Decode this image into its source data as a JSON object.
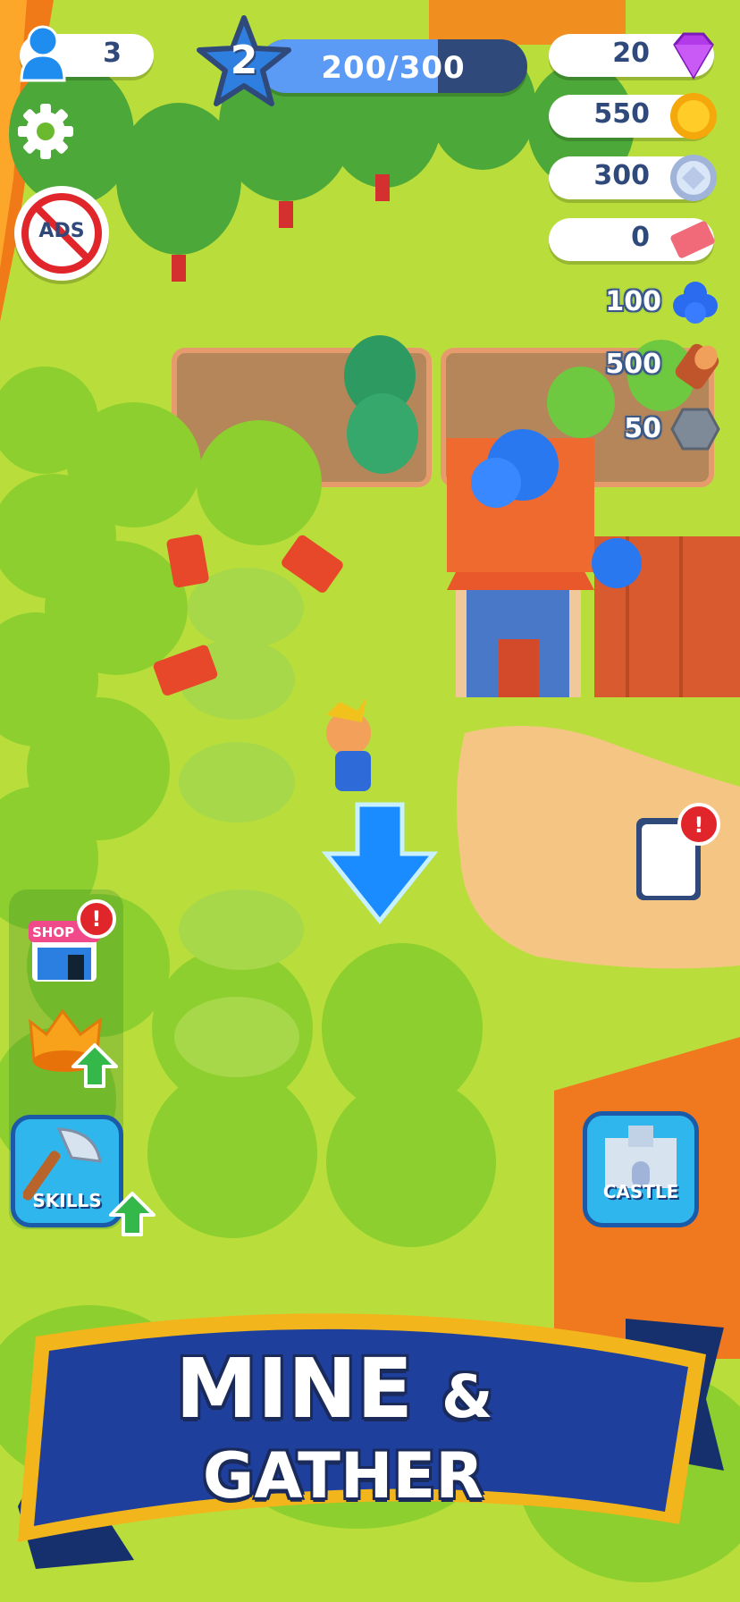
{
  "hud": {
    "players": "3",
    "level": "2",
    "xp_progress": "200/300",
    "xp_fraction": 0.6667,
    "gems": "20",
    "coins": "550",
    "silver": "300",
    "tickets": "0"
  },
  "resources": {
    "berries": "100",
    "wood": "500",
    "stone": "50"
  },
  "buttons": {
    "ads_label": "ADS",
    "shop_label": "SHOP",
    "skills_label": "SKILLS",
    "castle_label": "CASTLE"
  },
  "banner": {
    "line1": "MINE",
    "amp": "&",
    "line2": "GATHER"
  },
  "colors": {
    "grass": "#b6dc3a",
    "banner_blue": "#1e3f9c",
    "banner_gold": "#f2b51c",
    "button_blue": "#2fb6ec",
    "alert_red": "#e0262b"
  }
}
